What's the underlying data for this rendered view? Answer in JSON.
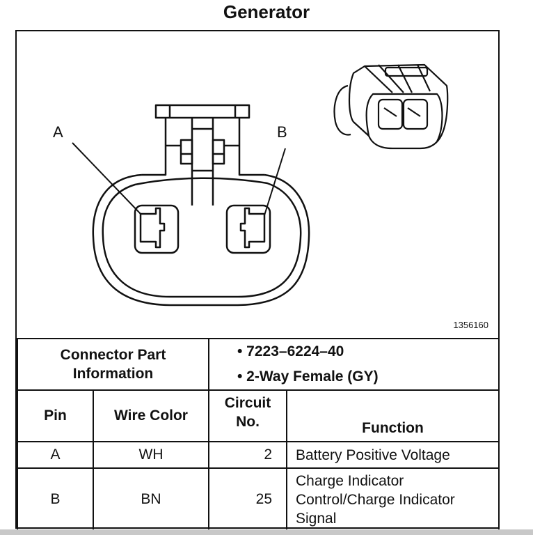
{
  "title": "Generator",
  "diagram": {
    "labels": {
      "pin_a": "A",
      "pin_b": "B"
    },
    "figure_number": "1356160"
  },
  "connector_info": {
    "label_line1": "Connector Part",
    "label_line2": "Information",
    "items": [
      "• 7223–6224–40",
      "• 2-Way Female (GY)"
    ]
  },
  "table": {
    "headers": {
      "pin": "Pin",
      "wire_color": "Wire Color",
      "circuit_line1": "Circuit",
      "circuit_line2": "No.",
      "function": "Function"
    },
    "rows": [
      {
        "pin": "A",
        "wire_color": "WH",
        "circuit": "2",
        "function": [
          "Battery Positive Voltage"
        ]
      },
      {
        "pin": "B",
        "wire_color": "BN",
        "circuit": "25",
        "function": [
          "Charge Indicator",
          "Control/Charge Indicator",
          "Signal"
        ]
      }
    ]
  }
}
